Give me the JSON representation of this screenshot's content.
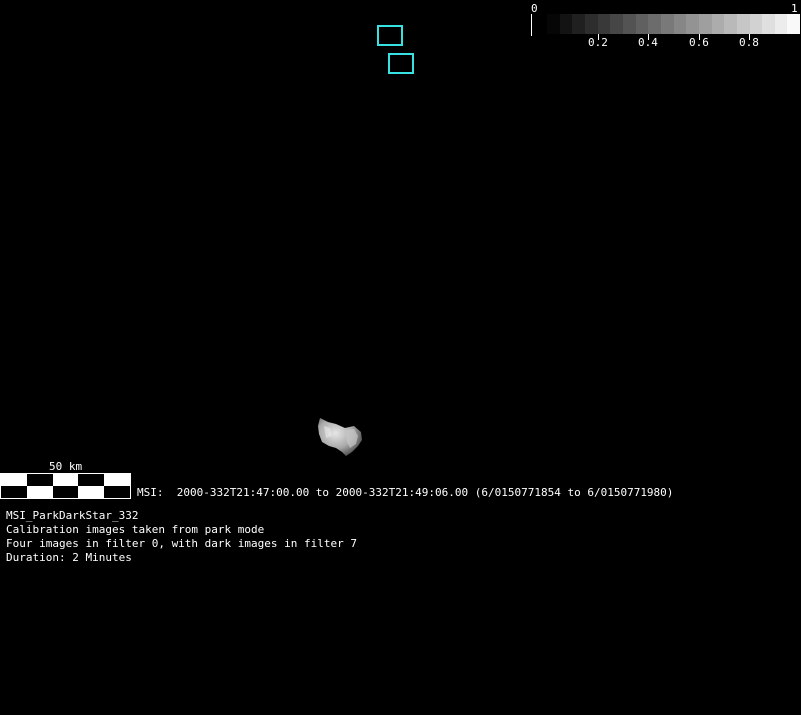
{
  "colorbar": {
    "min_label": "0",
    "max_label": "1",
    "ticks": [
      "0.2",
      "0.4",
      "0.6",
      "0.8"
    ],
    "tick_values": [
      0.2,
      0.4,
      0.6,
      0.8
    ],
    "steps": 20
  },
  "scale_bar": {
    "label": "50 km"
  },
  "observation": {
    "time_line": "MSI:  2000-332T21:47:00.00 to 2000-332T21:49:06.00 (6/0150771854 to 6/0150771980)",
    "name": "MSI_ParkDarkStar_332",
    "description_1": "Calibration images taken from park mode",
    "description_2": "Four images in filter 0, with dark images in filter 7",
    "duration": "Duration: 2 Minutes"
  },
  "colors": {
    "footprint": "#38e2e2",
    "background": "#000000"
  }
}
